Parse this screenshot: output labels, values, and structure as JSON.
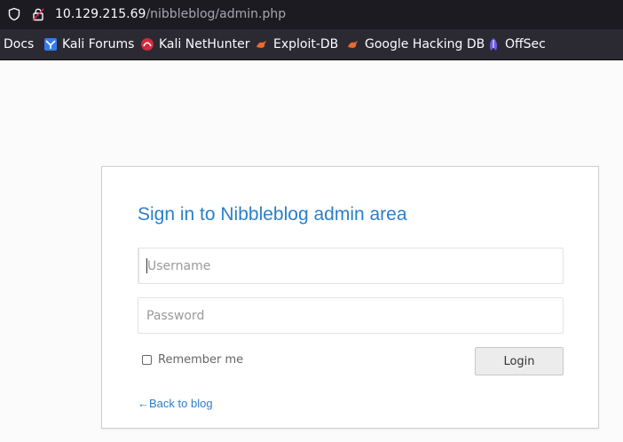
{
  "browser": {
    "url_host": "10.129.215.69",
    "url_path": "/nibbleblog/admin.php",
    "bookmarks": [
      {
        "label": "Docs",
        "icon": "none"
      },
      {
        "label": "Kali Forums",
        "icon": "kali-forums-icon"
      },
      {
        "label": "Kali NetHunter",
        "icon": "kali-nethunter-icon"
      },
      {
        "label": "Exploit-DB",
        "icon": "exploit-db-icon"
      },
      {
        "label": "Google Hacking DB",
        "icon": "google-hacking-db-icon"
      },
      {
        "label": "OffSec",
        "icon": "offsec-icon"
      }
    ]
  },
  "login": {
    "title": "Sign in to Nibbleblog admin area",
    "username_placeholder": "Username",
    "username_value": "",
    "password_placeholder": "Password",
    "password_value": "",
    "remember_label": "Remember me",
    "remember_checked": false,
    "login_button": "Login",
    "back_link": "←Back to blog"
  },
  "colors": {
    "accent": "#2a7fca",
    "urlbar_bg": "#1c1b22",
    "bookmarks_bg": "#2b2a33"
  }
}
